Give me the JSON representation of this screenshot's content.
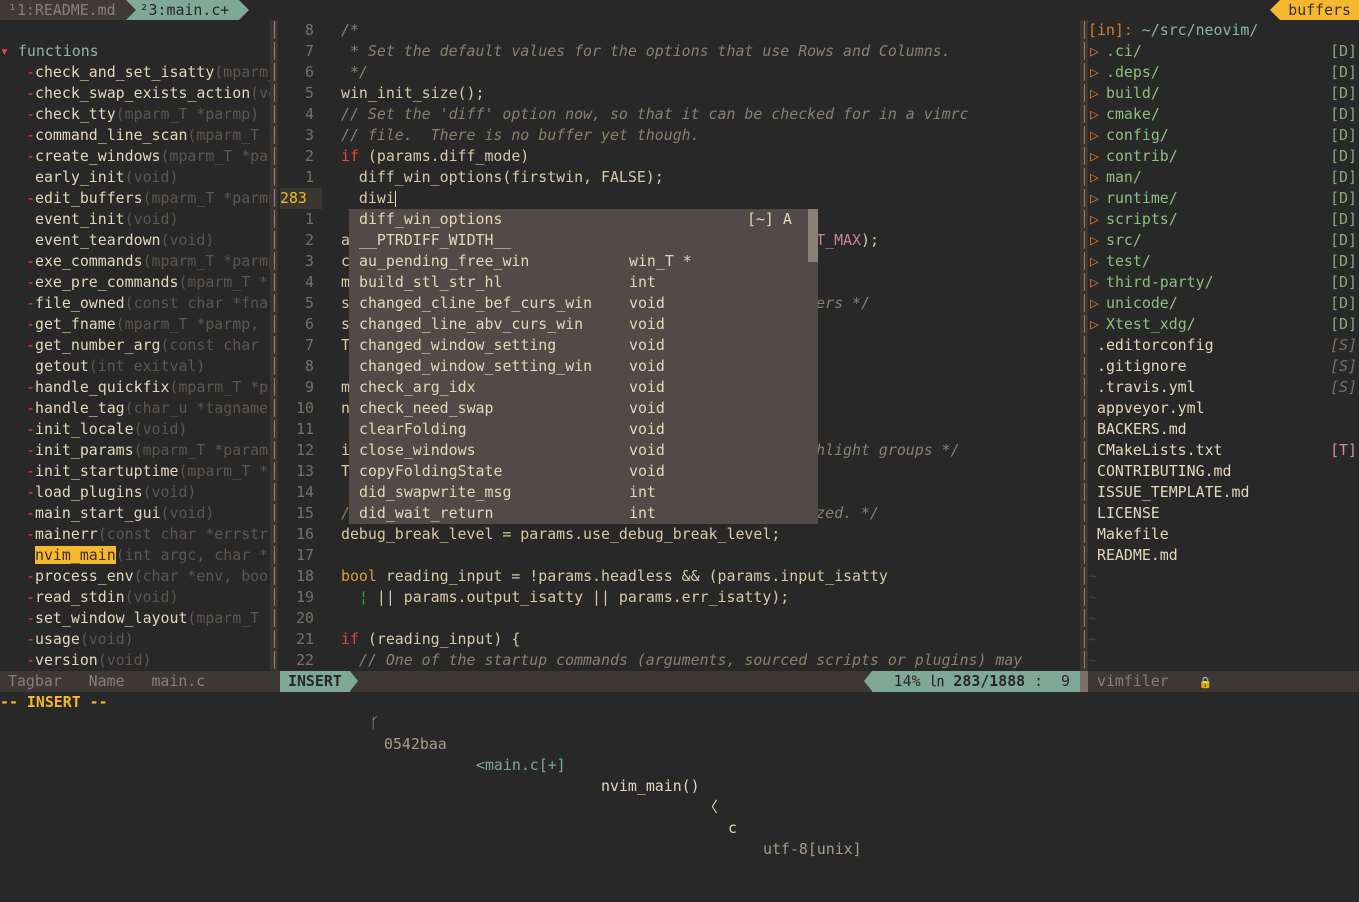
{
  "tabline": {
    "tabs": [
      {
        "label": "¹1:README.md",
        "active": false
      },
      {
        "label": "²3:main.c+",
        "active": true
      }
    ],
    "right_label": "buffers"
  },
  "tagbar": {
    "header": "functions",
    "items": [
      {
        "marker": "-",
        "name": "check_and_set_isatty",
        "sig": "(mparm_T *parmp)"
      },
      {
        "marker": "-",
        "name": "check_swap_exists_action",
        "sig": "(void)"
      },
      {
        "marker": "-",
        "name": "check_tty",
        "sig": "(mparm_T *parmp)"
      },
      {
        "marker": "-",
        "name": "command_line_scan",
        "sig": "(mparm_T *parmp)"
      },
      {
        "marker": "-",
        "name": "create_windows",
        "sig": "(mparm_T *parmp)"
      },
      {
        "marker": "",
        "name": "early_init",
        "sig": "(void)"
      },
      {
        "marker": "-",
        "name": "edit_buffers",
        "sig": "(mparm_T *parmp"
      },
      {
        "marker": "",
        "name": "event_init",
        "sig": "(void)"
      },
      {
        "marker": "",
        "name": "event_teardown",
        "sig": "(void)"
      },
      {
        "marker": "-",
        "name": "exe_commands",
        "sig": "(mparm_T *parmp"
      },
      {
        "marker": "-",
        "name": "exe_pre_commands",
        "sig": "(mparm_T *"
      },
      {
        "marker": "-",
        "name": "file_owned",
        "sig": "(const char *fna"
      },
      {
        "marker": "-",
        "name": "get_fname",
        "sig": "(mparm_T *parmp,"
      },
      {
        "marker": "-",
        "name": "get_number_arg",
        "sig": "(const char"
      },
      {
        "marker": "",
        "name": "getout",
        "sig": "(int exitval)"
      },
      {
        "marker": "-",
        "name": "handle_quickfix",
        "sig": "(mparm_T *p"
      },
      {
        "marker": "-",
        "name": "handle_tag",
        "sig": "(char_u *tagname"
      },
      {
        "marker": "-",
        "name": "init_locale",
        "sig": "(void)"
      },
      {
        "marker": "-",
        "name": "init_params",
        "sig": "(mparm_T *param"
      },
      {
        "marker": "-",
        "name": "init_startuptime",
        "sig": "(mparm_T *"
      },
      {
        "marker": "-",
        "name": "load_plugins",
        "sig": "(void)"
      },
      {
        "marker": "-",
        "name": "main_start_gui",
        "sig": "(void)"
      },
      {
        "marker": "-",
        "name": "mainerr",
        "sig": "(const char *errstr"
      },
      {
        "marker": "",
        "name": "nvim_main",
        "sig": "(int argc, char *",
        "highlight": true
      },
      {
        "marker": "-",
        "name": "process_env",
        "sig": "(char *env, boo"
      },
      {
        "marker": "-",
        "name": "read_stdin",
        "sig": "(void)"
      },
      {
        "marker": "-",
        "name": "set_window_layout",
        "sig": "(mparm_T"
      },
      {
        "marker": "-",
        "name": "usage",
        "sig": "(void)"
      },
      {
        "marker": "-",
        "name": "version",
        "sig": "(void)"
      }
    ]
  },
  "editor": {
    "lines": [
      {
        "n": "8",
        "s": [
          [
            "/*",
            "cm"
          ]
        ]
      },
      {
        "n": "7",
        "s": [
          [
            " * Set the default values for the options that use Rows and Columns.",
            "cm"
          ]
        ]
      },
      {
        "n": "6",
        "s": [
          [
            " */",
            "cm"
          ]
        ]
      },
      {
        "n": "5",
        "s": [
          [
            "win_init_size();",
            ""
          ]
        ]
      },
      {
        "n": "4",
        "s": [
          [
            "// Set the 'diff' option now, so that it can be checked for in a vimrc",
            "cm"
          ]
        ]
      },
      {
        "n": "3",
        "s": [
          [
            "// file.  There is no buffer yet though.",
            "cm"
          ]
        ]
      },
      {
        "n": "2",
        "s": [
          [
            "if",
            "kw"
          ],
          [
            " (params.diff_mode)",
            ""
          ]
        ]
      },
      {
        "n": "1",
        "s": [
          [
            "  diff_win_options(firstwin, FALSE);",
            ""
          ]
        ]
      },
      {
        "n": "283",
        "current": true,
        "s": [
          [
            "  diwi",
            ""
          ]
        ],
        "cursor": true
      },
      {
        "n": "1",
        "s": []
      },
      {
        "n": "2",
        "s": [
          [
            "a                                                    ",
            ""
          ],
          [
            "T_MAX",
            "cn"
          ],
          [
            ");",
            ""
          ]
        ]
      },
      {
        "n": "3",
        "s": [
          [
            "c",
            ""
          ]
        ]
      },
      {
        "n": "4",
        "s": [
          [
            "m",
            ""
          ]
        ]
      },
      {
        "n": "5",
        "s": [
          [
            "s                                                    ",
            ""
          ],
          [
            "ers */",
            "cm"
          ]
        ]
      },
      {
        "n": "6",
        "s": [
          [
            "s",
            ""
          ]
        ]
      },
      {
        "n": "7",
        "s": [
          [
            "T",
            ""
          ]
        ]
      },
      {
        "n": "8",
        "s": []
      },
      {
        "n": "9",
        "s": [
          [
            "m",
            ""
          ]
        ]
      },
      {
        "n": "10",
        "s": [
          [
            "n",
            ""
          ]
        ]
      },
      {
        "n": "11",
        "s": []
      },
      {
        "n": "12",
        "s": [
          [
            "i                                                    ",
            ""
          ],
          [
            "hlight groups */",
            "cm"
          ]
        ]
      },
      {
        "n": "13",
        "s": [
          [
            "T",
            ""
          ]
        ]
      },
      {
        "n": "14",
        "s": []
      },
      {
        "n": "15",
        "s": [
          [
            "/                                                    ",
            "cm"
          ],
          [
            "zed. */",
            "cm"
          ]
        ]
      },
      {
        "n": "16",
        "s": [
          [
            "debug_break_level = params.use_debug_break_level;",
            ""
          ]
        ]
      },
      {
        "n": "17",
        "s": []
      },
      {
        "n": "18",
        "s": [
          [
            "bool",
            "ty"
          ],
          [
            " reading_input = !params.headless && (params.input_isatty",
            ""
          ]
        ]
      },
      {
        "n": "19",
        "s": [
          [
            "  ",
            ""
          ],
          [
            "¦",
            "ig"
          ],
          [
            " || params.output_isatty || params.err_isatty);",
            ""
          ]
        ]
      },
      {
        "n": "20",
        "s": []
      },
      {
        "n": "21",
        "s": [
          [
            "if",
            "kw"
          ],
          [
            " (reading_input) {",
            ""
          ]
        ]
      },
      {
        "n": "22",
        "s": [
          [
            "  // One of the startup commands (arguments, sourced scripts or plugins) may",
            "cm"
          ]
        ]
      }
    ]
  },
  "completion": {
    "items": [
      {
        "word": "diff_win_options",
        "kind": "",
        "menu": "[~] A"
      },
      {
        "word": "__PTRDIFF_WIDTH__",
        "kind": ""
      },
      {
        "word": "au_pending_free_win",
        "kind": "win_T *"
      },
      {
        "word": "build_stl_str_hl",
        "kind": "int"
      },
      {
        "word": "changed_cline_bef_curs_win",
        "kind": "void"
      },
      {
        "word": "changed_line_abv_curs_win",
        "kind": "void"
      },
      {
        "word": "changed_window_setting",
        "kind": "void"
      },
      {
        "word": "changed_window_setting_win",
        "kind": "void"
      },
      {
        "word": "check_arg_idx",
        "kind": "void"
      },
      {
        "word": "check_need_swap",
        "kind": "void"
      },
      {
        "word": "clearFolding",
        "kind": "void"
      },
      {
        "word": "close_windows",
        "kind": "void"
      },
      {
        "word": "copyFoldingState",
        "kind": "void"
      },
      {
        "word": "did_swapwrite_msg",
        "kind": "int"
      },
      {
        "word": "did_wait_return",
        "kind": "int"
      }
    ],
    "scroll_fraction": 0.17
  },
  "filer": {
    "header_label": "[in]:",
    "path": " ~/src/neovim/",
    "entries": [
      {
        "name": ".ci/",
        "dir": true,
        "tag": "[D]"
      },
      {
        "name": ".deps/",
        "dir": true,
        "tag": "[D]"
      },
      {
        "name": "build/",
        "dir": true,
        "tag": "[D]"
      },
      {
        "name": "cmake/",
        "dir": true,
        "tag": "[D]"
      },
      {
        "name": "config/",
        "dir": true,
        "tag": "[D]"
      },
      {
        "name": "contrib/",
        "dir": true,
        "tag": "[D]"
      },
      {
        "name": "man/",
        "dir": true,
        "tag": "[D]"
      },
      {
        "name": "runtime/",
        "dir": true,
        "tag": "[D]"
      },
      {
        "name": "scripts/",
        "dir": true,
        "tag": "[D]"
      },
      {
        "name": "src/",
        "dir": true,
        "tag": "[D]"
      },
      {
        "name": "test/",
        "dir": true,
        "tag": "[D]"
      },
      {
        "name": "third-party/",
        "dir": true,
        "tag": "[D]"
      },
      {
        "name": "unicode/",
        "dir": true,
        "tag": "[D]"
      },
      {
        "name": "Xtest_xdg/",
        "dir": true,
        "tag": "[D]"
      },
      {
        "name": ".editorconfig",
        "tag": "[S]"
      },
      {
        "name": ".gitignore",
        "tag": "[S]"
      },
      {
        "name": ".travis.yml",
        "tag": "[S]"
      },
      {
        "name": "appveyor.yml",
        "tag": ""
      },
      {
        "name": "BACKERS.md",
        "tag": ""
      },
      {
        "name": "CMakeLists.txt",
        "tag": "[T]"
      },
      {
        "name": "CONTRIBUTING.md",
        "tag": ""
      },
      {
        "name": "ISSUE_TEMPLATE.md",
        "tag": ""
      },
      {
        "name": "LICENSE",
        "tag": ""
      },
      {
        "name": "Makefile",
        "tag": ""
      },
      {
        "name": "README.md",
        "tag": ""
      }
    ],
    "tilde_rows": 5,
    "triangle": "▷",
    "tilde": "~"
  },
  "statusline": {
    "left": "Tagbar   Name   main.c",
    "mode": "INSERT",
    "branch_icon": "ᚴ",
    "branch": "0542baa",
    "file": "<main.c[+]",
    "func": "nvim_main()",
    "sep": "〈",
    "filetype": "c",
    "encoding": "utf-8[unix]",
    "percent": "14%",
    "ln_icon": "㏑",
    "position": "283/1888",
    "colon": ":",
    "column": "9",
    "right": "vimfiler",
    "lock_icon": "🔒"
  },
  "cmdline": "-- INSERT --",
  "colors": {
    "accent_green": "#7fa898",
    "accent_yellow": "#f5b82e",
    "keyword_red": "#e8483a",
    "background": "#282828"
  }
}
